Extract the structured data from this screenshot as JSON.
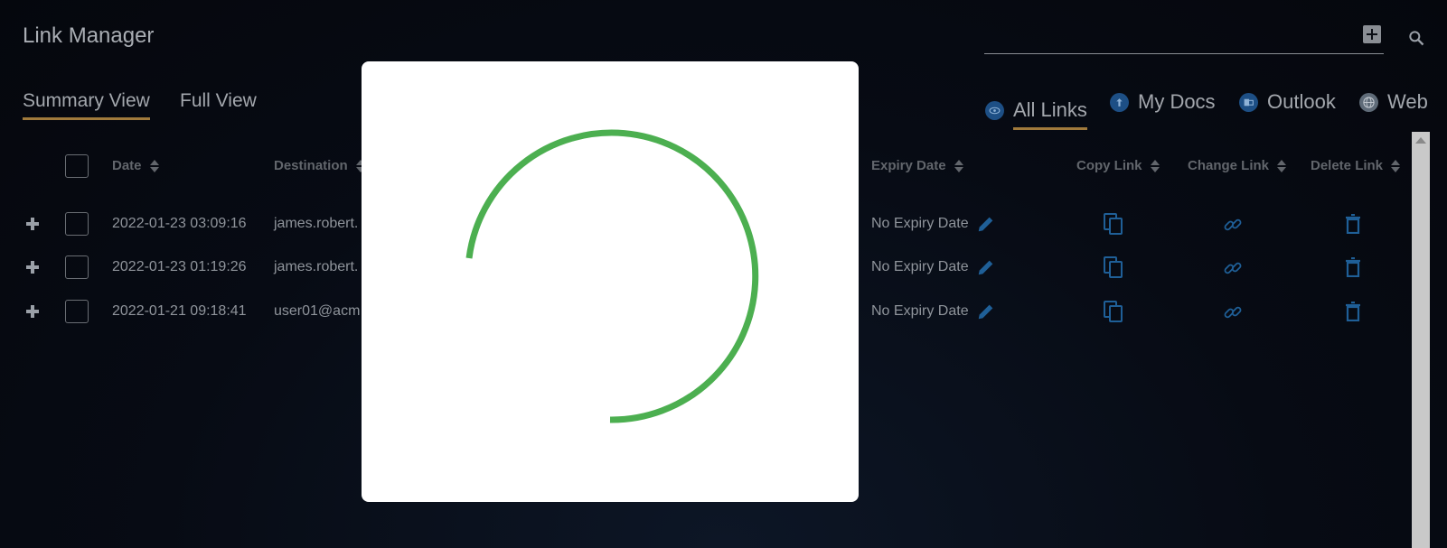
{
  "app": {
    "title": "Link Manager"
  },
  "views": {
    "summary": "Summary View",
    "full": "Full View"
  },
  "sources": {
    "all": "All Links",
    "docs": "My Docs",
    "outlook": "Outlook",
    "web": "Web"
  },
  "columns": {
    "date": "Date",
    "destination": "Destination",
    "expiry": "Expiry Date",
    "copy": "Copy Link",
    "change": "Change Link",
    "delete": "Delete Link"
  },
  "rows": [
    {
      "date": "2022-01-23 03:09:16",
      "destination": "james.robert.",
      "expiry": "No Expiry Date"
    },
    {
      "date": "2022-01-23 01:19:26",
      "destination": "james.robert.",
      "expiry": "No Expiry Date"
    },
    {
      "date": "2022-01-21 09:18:41",
      "destination": "user01@acm",
      "expiry": "No Expiry Date"
    }
  ],
  "colors": {
    "accent": "#a07a3c",
    "icon_blue": "#1f5f97",
    "spinner": "#4caf50"
  },
  "icons": [
    "add-box-icon",
    "search-icon",
    "eye-icon",
    "upload-icon",
    "outlook-icon",
    "globe-icon",
    "plus-icon",
    "pencil-icon",
    "copy-icon",
    "link-icon",
    "trash-icon"
  ]
}
